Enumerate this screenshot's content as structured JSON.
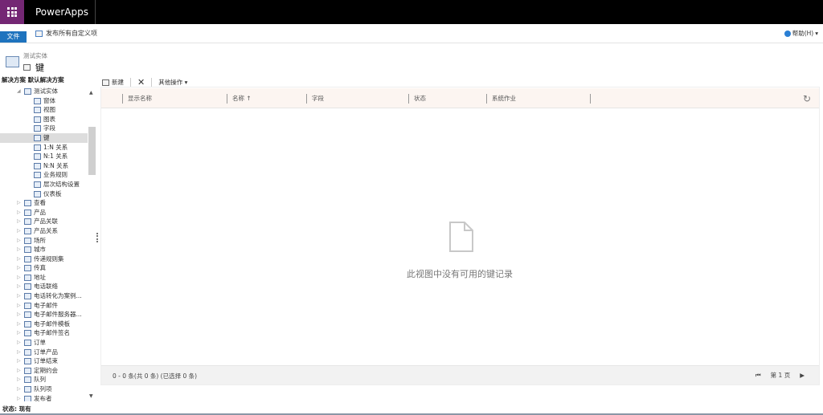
{
  "app": {
    "title": "PowerApps"
  },
  "ribbon": {
    "file_label": "文件",
    "publish_label": "发布所有自定义项",
    "help_label": "帮助(H)"
  },
  "header": {
    "entity_type": "测试实体",
    "entity_title": "键"
  },
  "sidebar": {
    "solution_label": "解决方案 默认解决方案",
    "items": [
      {
        "label": "测试实体",
        "level": 1,
        "expanded": true
      },
      {
        "label": "窗体",
        "level": 2
      },
      {
        "label": "视图",
        "level": 2
      },
      {
        "label": "图表",
        "level": 2
      },
      {
        "label": "字段",
        "level": 2
      },
      {
        "label": "键",
        "level": 2,
        "selected": true
      },
      {
        "label": "1:N 关系",
        "level": 2
      },
      {
        "label": "N:1 关系",
        "level": 2
      },
      {
        "label": "N:N 关系",
        "level": 2
      },
      {
        "label": "业务规则",
        "level": 2
      },
      {
        "label": "层次结构设置",
        "level": 2
      },
      {
        "label": "仪表板",
        "level": 2
      },
      {
        "label": "查看",
        "level": 1
      },
      {
        "label": "产品",
        "level": 1
      },
      {
        "label": "产品关联",
        "level": 1
      },
      {
        "label": "产品关系",
        "level": 1
      },
      {
        "label": "场所",
        "level": 1
      },
      {
        "label": "城市",
        "level": 1
      },
      {
        "label": "传递规则集",
        "level": 1
      },
      {
        "label": "传真",
        "level": 1
      },
      {
        "label": "地址",
        "level": 1
      },
      {
        "label": "电话联络",
        "level": 1
      },
      {
        "label": "电话转化为案例...",
        "level": 1
      },
      {
        "label": "电子邮件",
        "level": 1
      },
      {
        "label": "电子邮件服务器...",
        "level": 1
      },
      {
        "label": "电子邮件模板",
        "level": 1
      },
      {
        "label": "电子邮件签名",
        "level": 1
      },
      {
        "label": "订单",
        "level": 1
      },
      {
        "label": "订单产品",
        "level": 1
      },
      {
        "label": "订单结束",
        "level": 1
      },
      {
        "label": "定期约会",
        "level": 1
      },
      {
        "label": "队列",
        "level": 1
      },
      {
        "label": "队列项",
        "level": 1
      },
      {
        "label": "发布者",
        "level": 1
      }
    ]
  },
  "toolbar": {
    "new_label": "新建",
    "more_label": "其他操作"
  },
  "grid": {
    "columns": [
      "显示名称",
      "名称 ↑",
      "字段",
      "状态",
      "系统作业"
    ],
    "empty_message": "此视图中没有可用的键记录",
    "record_count": "0 - 0 条(共 0 条) (已选择 0 条)",
    "page_label": "第 1 页"
  },
  "status": {
    "text": "状态: 现有"
  }
}
